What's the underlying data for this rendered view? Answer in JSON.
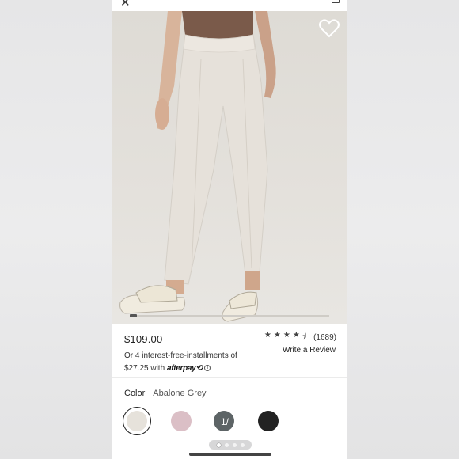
{
  "header": {
    "close_icon": "close-icon",
    "title": "",
    "bag_icon": "bag-icon"
  },
  "product": {
    "price": "$109.00",
    "installments_text": "Or 4 interest-free-installments of",
    "installment_amount": "$27.25 with",
    "afterpay_brand": "afterpay",
    "afterpay_glyph": "⟲",
    "info_glyph": "i",
    "rating_value": 4.5,
    "rating_count": "(1689)",
    "write_review": "Write a Review",
    "stars": [
      "★",
      "★",
      "★",
      "★",
      "⯨"
    ]
  },
  "color": {
    "label": "Color",
    "value": "Abalone Grey",
    "swatches": [
      {
        "name": "Abalone Grey",
        "hex": "#e6e2db"
      },
      {
        "name": "Pink",
        "hex": "#dbbfc6"
      },
      {
        "name": "Slate",
        "hex": "#5d6466"
      },
      {
        "name": "Black",
        "hex": "#222222"
      }
    ],
    "swatch_overlay": "1/"
  },
  "pager": {
    "count": 4,
    "active": 0
  },
  "colors": {
    "accent": "#222222",
    "photo_bg": "#e2dfda"
  }
}
